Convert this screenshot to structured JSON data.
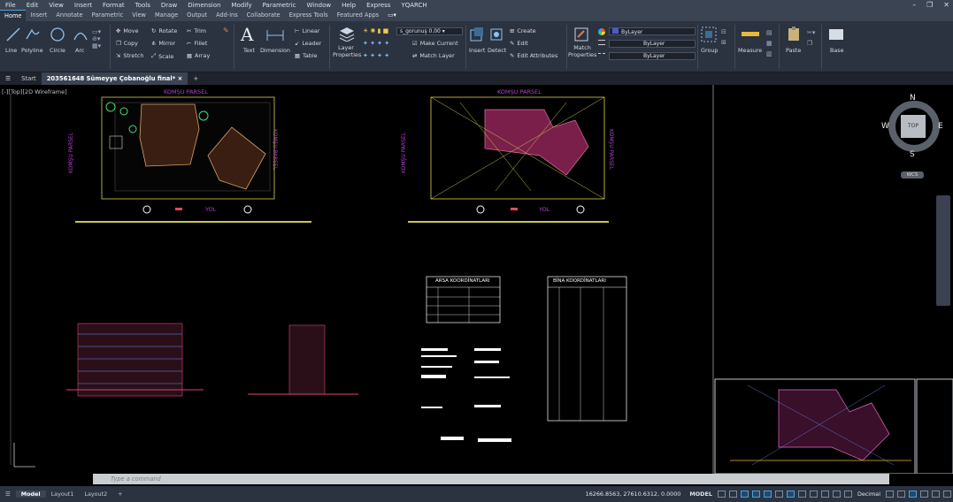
{
  "menu": [
    "File",
    "Edit",
    "View",
    "Insert",
    "Format",
    "Tools",
    "Draw",
    "Dimension",
    "Modify",
    "Parametric",
    "Window",
    "Help",
    "Express",
    "YQARCH"
  ],
  "ribbon_tabs": [
    "Home",
    "Insert",
    "Annotate",
    "Parametric",
    "View",
    "Manage",
    "Output",
    "Add-ins",
    "Collaborate",
    "Express Tools",
    "Featured Apps"
  ],
  "active_tab": "Home",
  "draw": {
    "line": "Line",
    "polyline": "Polyline",
    "circle": "Circle",
    "arc": "Arc"
  },
  "modify": {
    "move": "Move",
    "rotate": "Rotate",
    "trim": "Trim",
    "copy": "Copy",
    "mirror": "Mirror",
    "fillet": "Fillet",
    "stretch": "Stretch",
    "scale": "Scale",
    "array": "Array"
  },
  "annotation": {
    "text": "Text",
    "dimension": "Dimension",
    "linear": "Linear",
    "leader": "Leader",
    "table": "Table"
  },
  "layers": {
    "layer_properties": "Layer Properties",
    "current_layer": "s_gorunuş 0.00",
    "make_current": "Make Current",
    "match_layer": "Match Layer"
  },
  "block": {
    "insert": "Insert",
    "detect": "Detect",
    "create": "Create",
    "edit": "Edit",
    "edit_attributes": "Edit Attributes"
  },
  "properties": {
    "match": "Match Properties",
    "color": "ByLayer",
    "linetype": "ByLayer",
    "lineweight": "ByLayer"
  },
  "groups": {
    "group": "Group",
    "measure": "Measure",
    "paste": "Paste",
    "base": "Base"
  },
  "document_tabs": {
    "start": "Start",
    "file": "203561648 Sümeyye Çobanoğlu final*"
  },
  "viewport_label": "[-][Top][2D Wireframe]",
  "viewcube": {
    "n": "N",
    "s": "S",
    "e": "E",
    "w": "W",
    "top": "TOP",
    "wcs": "WCS"
  },
  "drawing": {
    "komsu_parsel": "KOMŞU PARSEL",
    "yol": "YOL",
    "arsa_title": "ARSA KOORDİNATLARI",
    "bina_title": "BİNA KOORDİNATLARI"
  },
  "command": {
    "placeholder": "Type a command"
  },
  "status": {
    "layouts": [
      "Model",
      "Layout1",
      "Layout2"
    ],
    "coords": "16266.8563, 27610.6312, 0.0000",
    "model": "MODEL",
    "units": "Decimal"
  }
}
